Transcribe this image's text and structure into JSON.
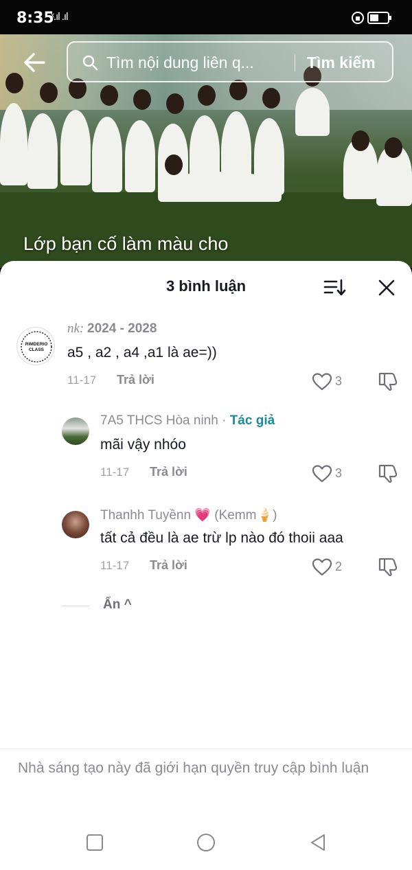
{
  "status_bar": {
    "time": "8:35",
    "signal": "ˣ.ıl .ıl"
  },
  "search": {
    "placeholder": "Tìm nội dung liên q...",
    "button_label": "Tìm kiếm"
  },
  "video": {
    "caption": "Lớp bạn cố làm màu cho"
  },
  "sheet": {
    "title": "3 bình luận"
  },
  "comments": [
    {
      "username_prefix": "nk: ",
      "username": "2024 - 2028",
      "avatar_text": "RIMDERIO CLASS",
      "text": "a5 , a2 , a4 ,a1 là ae=))",
      "date": "11-17",
      "reply_label": "Trả lời",
      "likes": "3"
    },
    {
      "username": "7A5 THCS Hòa ninh",
      "author_sep": " · ",
      "author_badge": "Tác giả",
      "text": "mãi vậy nhóo",
      "date": "11-17",
      "reply_label": "Trả lời",
      "likes": "3"
    },
    {
      "username": "Thanhh Tuyềnn 💗 (Kemm🍦)",
      "text": "tất cả đều là ae trừ lp nào đó thoii aaa",
      "date": "11-17",
      "reply_label": "Trả lời",
      "likes": "2"
    }
  ],
  "hide_replies": "Ẩn ^",
  "restriction_notice": "Nhà sáng tạo này đã giới hạn quyền truy cập bình luận",
  "colors": {
    "author_badge": "#1b8a9b",
    "text_primary": "#161823",
    "text_secondary": "#8a8b91"
  },
  "icons": [
    "back-arrow-icon",
    "search-icon",
    "sort-icon",
    "close-icon",
    "heart-icon",
    "dislike-icon",
    "square-nav-icon",
    "circle-nav-icon",
    "triangle-back-icon"
  ]
}
